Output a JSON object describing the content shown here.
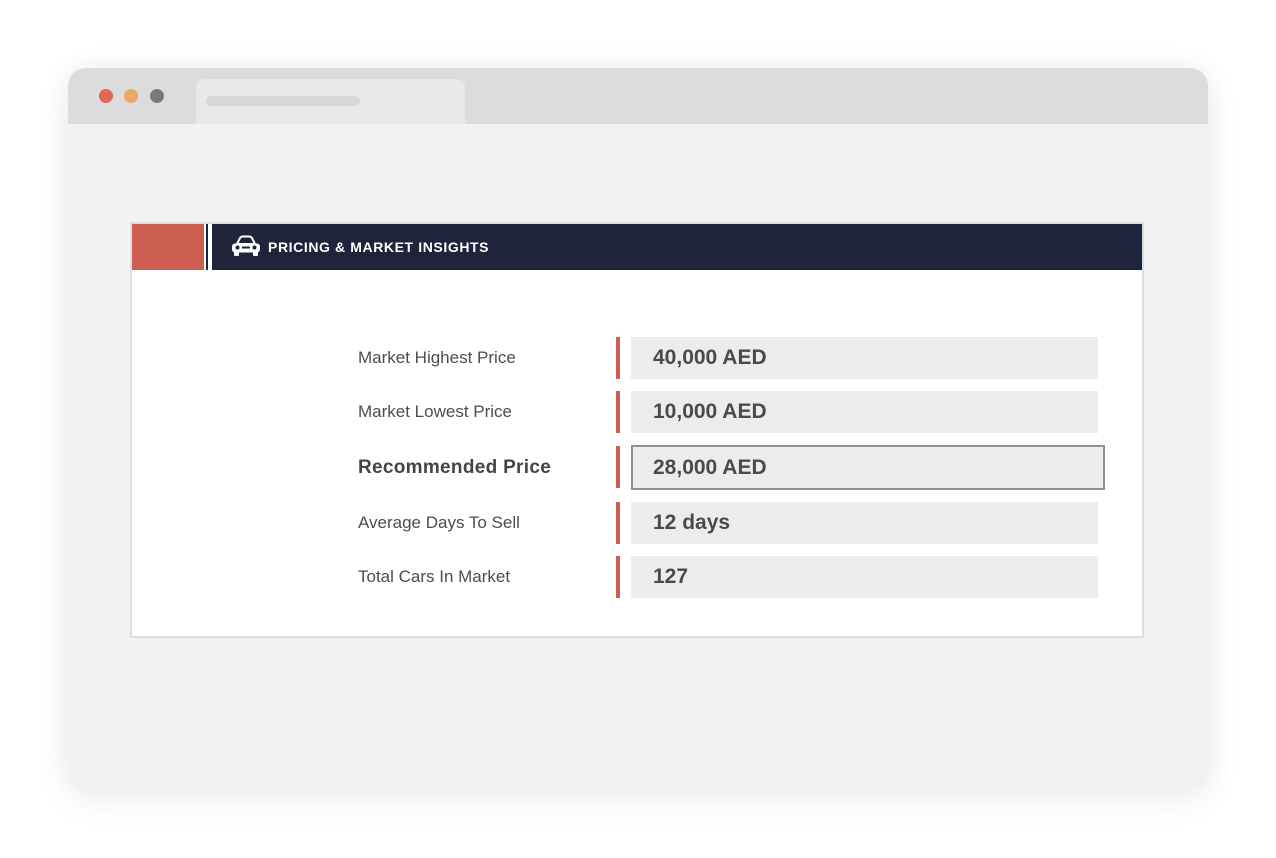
{
  "card": {
    "title": "PRICING & MARKET INSIGHTS",
    "icon": "car-icon"
  },
  "colors": {
    "accent": "#cc5f52",
    "header_bg": "#1f243a",
    "value_bg": "#ececea"
  },
  "rows": [
    {
      "label": "Market Highest Price",
      "value": "40,000 AED"
    },
    {
      "label": "Market Lowest Price",
      "value": "10,000 AED"
    },
    {
      "label": "Recommended Price",
      "value": "28,000 AED"
    },
    {
      "label": "Average Days To Sell",
      "value": "12 days"
    },
    {
      "label": "Total Cars In Market",
      "value": "127"
    }
  ]
}
